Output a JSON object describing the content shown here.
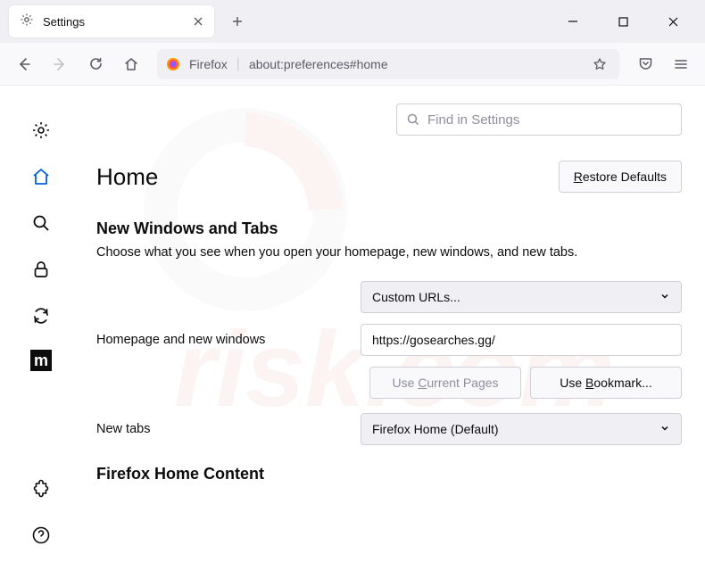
{
  "tab": {
    "title": "Settings"
  },
  "urlbar": {
    "label": "Firefox",
    "url": "about:preferences#home"
  },
  "search": {
    "placeholder": "Find in Settings"
  },
  "page": {
    "title": "Home",
    "restore_btn": "Restore Defaults"
  },
  "section1": {
    "title": "New Windows and Tabs",
    "desc": "Choose what you see when you open your homepage, new windows, and new tabs."
  },
  "homepage": {
    "label": "Homepage and new windows",
    "select_value": "Custom URLs...",
    "url_value": "https://gosearches.gg/",
    "use_current": "Use Current Pages",
    "use_bookmark": "Use Bookmark..."
  },
  "newtabs": {
    "label": "New tabs",
    "select_value": "Firefox Home (Default)"
  },
  "section2": {
    "title": "Firefox Home Content"
  },
  "sidebar": {
    "m_label": "m"
  }
}
